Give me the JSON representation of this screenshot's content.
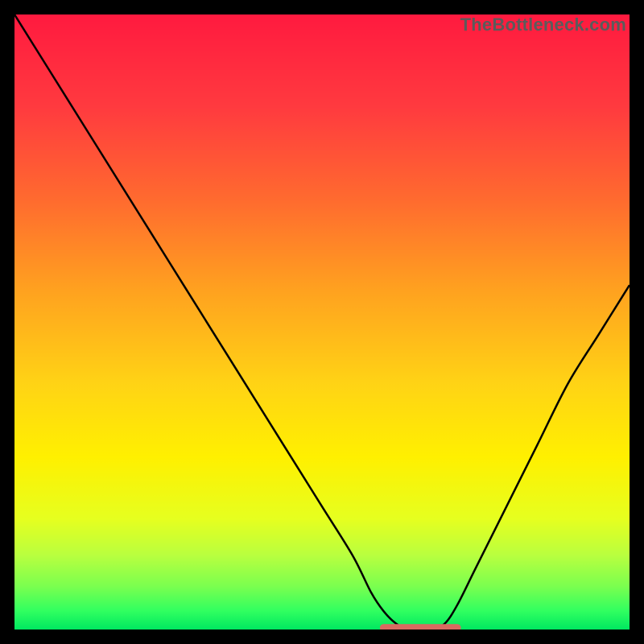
{
  "watermark": "TheBottleneck.com",
  "chart_data": {
    "type": "line",
    "title": "",
    "xlabel": "",
    "ylabel": "",
    "xlim": [
      0,
      100
    ],
    "ylim": [
      0,
      100
    ],
    "x": [
      0,
      5,
      10,
      15,
      20,
      25,
      30,
      35,
      40,
      45,
      50,
      55,
      58,
      60,
      62,
      64,
      66,
      68,
      70,
      72,
      75,
      80,
      85,
      90,
      95,
      100
    ],
    "values": [
      100,
      92,
      84,
      76,
      68,
      60,
      52,
      44,
      36,
      28,
      20,
      12,
      6,
      3,
      1,
      0,
      0,
      0,
      1,
      4,
      10,
      20,
      30,
      40,
      48,
      56
    ],
    "gradient_stops": [
      {
        "offset": 0.0,
        "color": "#ff1a3f"
      },
      {
        "offset": 0.15,
        "color": "#ff3a3f"
      },
      {
        "offset": 0.3,
        "color": "#ff6a2f"
      },
      {
        "offset": 0.45,
        "color": "#ffa21f"
      },
      {
        "offset": 0.6,
        "color": "#ffd315"
      },
      {
        "offset": 0.72,
        "color": "#fff000"
      },
      {
        "offset": 0.82,
        "color": "#e6ff1f"
      },
      {
        "offset": 0.88,
        "color": "#b8ff3f"
      },
      {
        "offset": 0.93,
        "color": "#7aff4f"
      },
      {
        "offset": 0.97,
        "color": "#30ff60"
      },
      {
        "offset": 1.0,
        "color": "#00e860"
      }
    ],
    "flat_segment": {
      "x_start": 60,
      "x_end": 72,
      "color": "#d86a60"
    }
  }
}
